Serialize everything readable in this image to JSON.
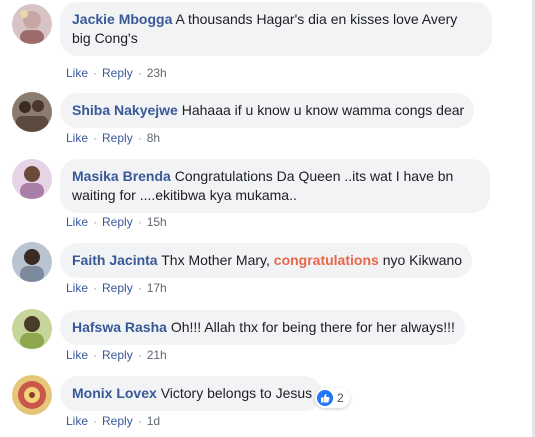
{
  "actions": {
    "like": "Like",
    "reply": "Reply",
    "separator": "·"
  },
  "comments": [
    {
      "name": "Jackie Mbogga",
      "line1": "A thousands Hagar's dia en kisses love Avery",
      "line2": "big Cong's",
      "time": "23h",
      "avatar_color": "#c9a6a6"
    },
    {
      "name": "Shiba Nakyejwe",
      "text": "Hahaaa if u know u know wamma congs dear",
      "time": "8h",
      "avatar_color": "#5c4a3e"
    },
    {
      "name": "Masika Brenda",
      "line1": "Congratulations Da Queen ..its wat I have bn",
      "line2": "waiting for ....ekitibwa kya mukama..",
      "time": "15h",
      "avatar_color": "#a77fa8"
    },
    {
      "name": "Faith Jacinta",
      "text_before": "Thx Mother Mary,",
      "highlight": "congratulations",
      "text_after": "nyo Kikwano",
      "time": "17h",
      "avatar_color": "#7a8a9c"
    },
    {
      "name": "Hafswa Rasha",
      "text": "Oh!!! Allah thx for being there for her always!!!",
      "time": "21h",
      "avatar_color": "#8fa84e"
    },
    {
      "name": "Monix Lovex",
      "text": "Victory belongs to Jesus",
      "time": "1d",
      "reaction_count": "2",
      "avatar_color": "#c9584a"
    }
  ]
}
